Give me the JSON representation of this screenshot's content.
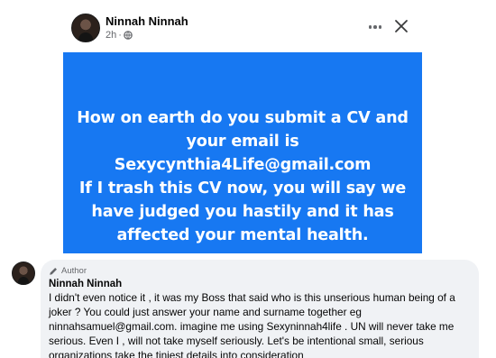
{
  "post": {
    "author": "Ninnah Ninnah",
    "time": "2h",
    "privacy_icon": "globe-icon",
    "image_lines": [
      "How on earth do you submit a CV and",
      "your email is",
      "Sexycynthia4Life@gmail.com",
      "If I trash this CV now, you will say we",
      "have judged you hastily and it has",
      "affected your mental health."
    ],
    "image_bg_color": "#1778f2"
  },
  "comment": {
    "badge": "Author",
    "author": "Ninnah Ninnah",
    "lines": [
      "I didn't even notice it , it was my Boss that said who is this unserious human being of a",
      "joker ? You could just answer your name and surname together eg",
      "ninnahsamuel@gmail.com. imagine me using Sexyninnah4life . UN will never take me",
      "serious. Even I , will not take myself seriously. Let's be intentional small, serious",
      "organizations take the tiniest details into consideration"
    ]
  }
}
